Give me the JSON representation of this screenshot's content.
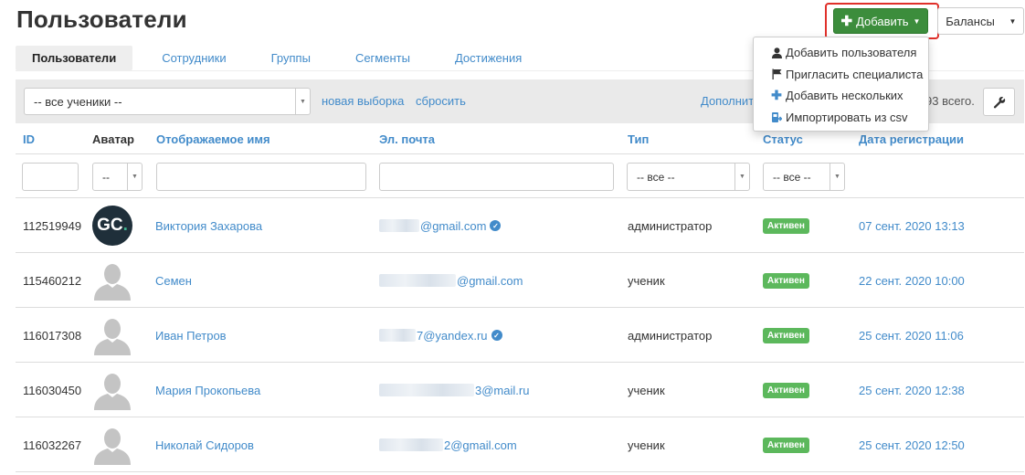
{
  "page": {
    "title": "Пользователи"
  },
  "header_buttons": {
    "add_label": "Добавить",
    "balances_label": "Балансы"
  },
  "add_menu": {
    "items": [
      {
        "label": "Добавить пользователя",
        "icon": "user-icon"
      },
      {
        "label": "Пригласить специалиста",
        "icon": "flag-icon"
      },
      {
        "label": "Добавить нескольких",
        "icon": "plus-icon"
      },
      {
        "label": "Импортировать из csv",
        "icon": "import-csv-icon"
      }
    ]
  },
  "tabs": [
    {
      "label": "Пользователи",
      "active": true
    },
    {
      "label": "Сотрудники",
      "active": false
    },
    {
      "label": "Группы",
      "active": false
    },
    {
      "label": "Сегменты",
      "active": false
    },
    {
      "label": "Достижения",
      "active": false
    }
  ],
  "filter": {
    "selection_value": "-- все ученики --",
    "new_selection_link": "новая выборка",
    "reset_link": "сбросить",
    "more_link": "Дополнит",
    "total_text": "93 всего."
  },
  "table": {
    "headers": {
      "id": "ID",
      "avatar": "Аватар",
      "name": "Отображаемое имя",
      "email": "Эл. почта",
      "type": "Тип",
      "status": "Статус",
      "date": "Дата регистрации"
    },
    "filters": {
      "avatar_select": "--",
      "type_select": "-- все --",
      "status_select": "-- все --"
    },
    "rows": [
      {
        "id": "112519949",
        "avatar": "gc-logo",
        "name": "Виктория Захарова",
        "email_visible": "@gmail.com",
        "verified": true,
        "type": "администратор",
        "status": "Активен",
        "date": "07 сент. 2020 13:13"
      },
      {
        "id": "115460212",
        "avatar": "placeholder",
        "name": "Семен",
        "email_visible": "@gmail.com",
        "verified": false,
        "type": "ученик",
        "status": "Активен",
        "date": "22 сент. 2020 10:00"
      },
      {
        "id": "116017308",
        "avatar": "placeholder",
        "name": "Иван Петров",
        "email_visible": "7@yandex.ru",
        "verified": true,
        "type": "администратор",
        "status": "Активен",
        "date": "25 сент. 2020 11:06"
      },
      {
        "id": "116030450",
        "avatar": "placeholder",
        "name": "Мария Прокопьева",
        "email_visible": "3@mail.ru",
        "verified": false,
        "type": "ученик",
        "status": "Активен",
        "date": "25 сент. 2020 12:38"
      },
      {
        "id": "116032267",
        "avatar": "placeholder",
        "name": "Николай Сидоров",
        "email_visible": "2@gmail.com",
        "verified": false,
        "type": "ученик",
        "status": "Активен",
        "date": "25 сент. 2020 12:50"
      }
    ]
  },
  "avatar_logo_text": {
    "g": "G",
    "c": "C",
    "dot": "."
  },
  "colors": {
    "primary": "#428bca",
    "success": "#3c8d3c",
    "badge": "#5cb85c",
    "highlight": "#e0302a"
  }
}
